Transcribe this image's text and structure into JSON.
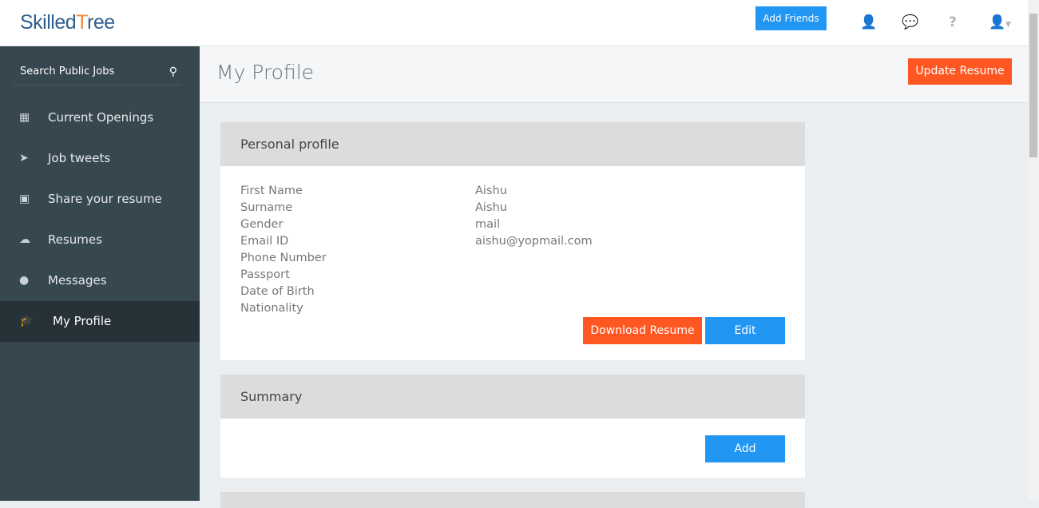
{
  "header": {
    "logo": "SkilledTree",
    "logo_a": "Skilled",
    "logo_b": "T",
    "logo_c": "ree",
    "add_friends": "Add Friends"
  },
  "sidebar": {
    "search_label": "Search Public Jobs",
    "items": [
      {
        "label": "Current Openings",
        "icon": "grid-icon"
      },
      {
        "label": "Job tweets",
        "icon": "paper-plane-icon"
      },
      {
        "label": "Share your resume",
        "icon": "briefcase-icon"
      },
      {
        "label": "Resumes",
        "icon": "cloud-upload-icon"
      },
      {
        "label": "Messages",
        "icon": "comment-icon"
      },
      {
        "label": "My Profile",
        "icon": "graduation-cap-icon"
      }
    ]
  },
  "page": {
    "title": "My Profile",
    "update_resume": "Update Resume"
  },
  "personal": {
    "title": "Personal profile",
    "fields": [
      {
        "label": "First Name",
        "value": "Aishu"
      },
      {
        "label": "Surname",
        "value": "Aishu"
      },
      {
        "label": "Gender",
        "value": "mail"
      },
      {
        "label": "Email ID",
        "value": "aishu@yopmail.com"
      },
      {
        "label": "Phone Number",
        "value": ""
      },
      {
        "label": "Passport",
        "value": ""
      },
      {
        "label": "Date of Birth",
        "value": ""
      },
      {
        "label": "Nationality",
        "value": ""
      }
    ],
    "download": "Download Resume",
    "edit": "Edit"
  },
  "summary": {
    "title": "Summary",
    "add": "Add"
  },
  "colors": {
    "accent_blue": "#2196f3",
    "accent_orange": "#ff5722",
    "sidebar": "#37474f"
  }
}
